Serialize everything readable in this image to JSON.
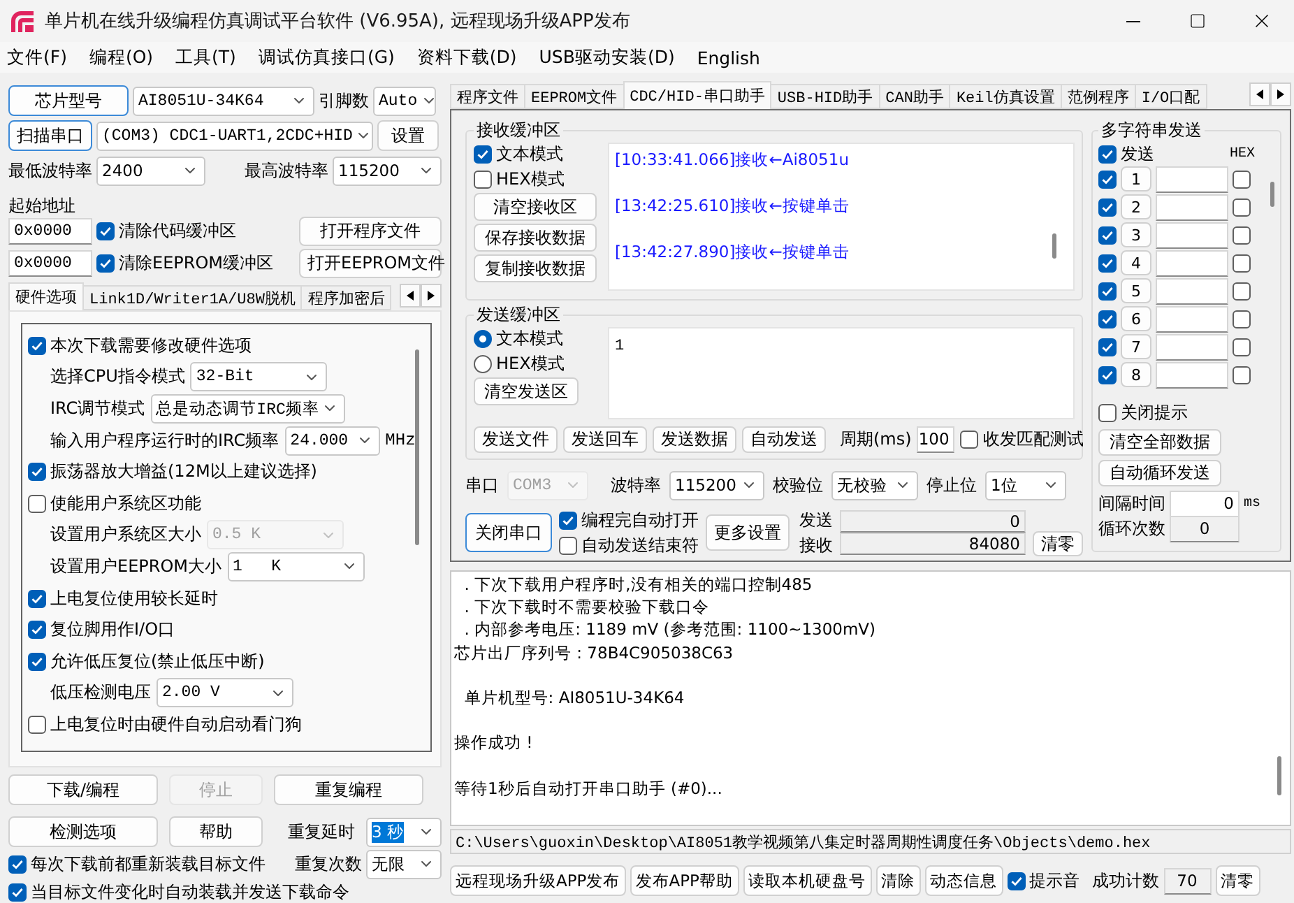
{
  "window": {
    "title": "单片机在线升级编程仿真调试平台软件 (V6.95A), 远程现场升级APP发布"
  },
  "menu": [
    "文件(F)",
    "编程(O)",
    "工具(T)",
    "调试仿真接口(G)",
    "资料下载(D)",
    "USB驱动安装(D)",
    "English"
  ],
  "chip": {
    "button": {
      "label": "芯片型号",
      "focused": true
    },
    "model": "AI8051U-34K64",
    "pins_label": "引脚数",
    "pins": "Auto"
  },
  "port": {
    "button": {
      "label": "扫描串口",
      "focused": true
    },
    "value": "(COM3) CDC1-UART1,2CDC+HID",
    "settings": "设置"
  },
  "baud": {
    "min_label": "最低波特率",
    "min": "2400",
    "max_label": "最高波特率",
    "max": "115200"
  },
  "start_address": {
    "label": "起始地址",
    "rows": [
      {
        "address": "0x0000",
        "label": "清除代码缓冲区",
        "checked": true,
        "button": "打开程序文件"
      },
      {
        "address": "0x0000",
        "label": "清除EEPROM缓冲区",
        "checked": true,
        "button": "打开EEPROM文件"
      }
    ]
  },
  "option_tabs": [
    {
      "label": "硬件选项",
      "selected": true
    },
    {
      "label": "Link1D/Writer1A/U8W脱机",
      "selected": false
    },
    {
      "label": "程序加密后",
      "selected": false
    }
  ],
  "hardware_options": [
    {
      "kind": "check",
      "label": "本次下载需要修改硬件选项",
      "checked": true
    },
    {
      "kind": "select",
      "label": "选择CPU指令模式",
      "value": "32-Bit",
      "disabled": false
    },
    {
      "kind": "select",
      "label": "IRC调节模式",
      "value": "总是动态调节IRC频率",
      "disabled": false
    },
    {
      "kind": "select",
      "label": "输入用户程序运行时的IRC频率",
      "value": "24.000",
      "unit": "MHz",
      "disabled": false
    },
    {
      "kind": "check",
      "label": "振荡器放大增益(12M以上建议选择)",
      "checked": true
    },
    {
      "kind": "check",
      "label": "使能用户系统区功能",
      "checked": false
    },
    {
      "kind": "select",
      "label": "设置用户系统区大小",
      "value": "0.5 K",
      "disabled": true
    },
    {
      "kind": "select",
      "label": "设置用户EEPROM大小",
      "value": "1   K",
      "disabled": false
    },
    {
      "kind": "check",
      "label": "上电复位使用较长延时",
      "checked": true
    },
    {
      "kind": "check",
      "label": "复位脚用作I/O口",
      "checked": true
    },
    {
      "kind": "check",
      "label": "允许低压复位(禁止低压中断)",
      "checked": true
    },
    {
      "kind": "select",
      "label": "低压检测电压",
      "value": "2.00 V",
      "disabled": false
    },
    {
      "kind": "check",
      "label": "上电复位时由硬件自动启动看门狗",
      "checked": false
    }
  ],
  "actions": [
    {
      "label": "下载/编程",
      "disabled": false
    },
    {
      "label": "停止",
      "disabled": true
    },
    {
      "label": "重复编程",
      "disabled": false
    },
    {
      "label": "检测选项",
      "disabled": false
    },
    {
      "label": "帮助",
      "disabled": false
    }
  ],
  "repeat_delay": {
    "label": "重复延时",
    "value": "3 秒",
    "highlighted": true
  },
  "repeat_count": {
    "label": "重复次数",
    "value": "无限"
  },
  "load_options": [
    {
      "label": "每次下载前都重新装载目标文件",
      "checked": true
    },
    {
      "label": "当目标文件变化时自动装载并发送下载命令",
      "checked": true
    }
  ],
  "tool_tabs": [
    {
      "label": "程序文件",
      "selected": false
    },
    {
      "label": "EEPROM文件",
      "selected": false
    },
    {
      "label": "CDC/HID-串口助手",
      "selected": true
    },
    {
      "label": "USB-HID助手",
      "selected": false
    },
    {
      "label": "CAN助手",
      "selected": false
    },
    {
      "label": "Keil仿真设置",
      "selected": false
    },
    {
      "label": "范例程序",
      "selected": false
    },
    {
      "label": "I/O口配",
      "selected": false
    }
  ],
  "receive": {
    "title": "接收缓冲区",
    "modes": [
      {
        "label": "文本模式",
        "checked": true
      },
      {
        "label": "HEX模式",
        "checked": false
      }
    ],
    "buttons": [
      "清空接收区",
      "保存接收数据",
      "复制接收数据"
    ],
    "lines": [
      "[10:33:41.066]接收←Ai8051u",
      "[13:42:25.610]接收←按键单击",
      "[13:42:27.890]接收←按键单击"
    ]
  },
  "send": {
    "title": "发送缓冲区",
    "modes": [
      {
        "label": "文本模式",
        "selected": true
      },
      {
        "label": "HEX模式",
        "selected": false
      }
    ],
    "clear": "清空发送区",
    "value": "1",
    "buttons": [
      "发送文件",
      "发送回车",
      "发送数据",
      "自动发送"
    ],
    "period_label": "周期(ms)",
    "period": "100",
    "match_test": {
      "label": "收发匹配测试",
      "checked": false
    }
  },
  "serial": {
    "port_label": "串口",
    "port": "COM3",
    "baud_label": "波特率",
    "baud": "115200",
    "parity_label": "校验位",
    "parity": "无校验",
    "stop_label": "停止位",
    "stop": "1位"
  },
  "connection": {
    "button": {
      "label": "关闭串口",
      "focused": true
    },
    "options": [
      {
        "label": "编程完自动打开",
        "checked": true
      },
      {
        "label": "自动发送结束符",
        "checked": false
      }
    ],
    "more": "更多设置",
    "sent_label": "发送",
    "sent": "0",
    "received_label": "接收",
    "received": "84080",
    "reset": "清零"
  },
  "multi_send": {
    "title": "多字符串发送",
    "send_all": {
      "label": "发送",
      "checked": true
    },
    "hex_label": "HEX",
    "rows": [
      {
        "label": "1",
        "checked": true,
        "hex": false
      },
      {
        "label": "2",
        "checked": true,
        "hex": false
      },
      {
        "label": "3",
        "checked": true,
        "hex": false
      },
      {
        "label": "4",
        "checked": true,
        "hex": false
      },
      {
        "label": "5",
        "checked": true,
        "hex": false
      },
      {
        "label": "6",
        "checked": true,
        "hex": false
      },
      {
        "label": "7",
        "checked": true,
        "hex": false
      },
      {
        "label": "8",
        "checked": true,
        "hex": false
      }
    ],
    "close_tip": {
      "label": "关闭提示",
      "checked": false
    },
    "buttons": [
      "清空全部数据",
      "自动循环发送"
    ],
    "interval_label": "间隔时间",
    "interval": "0",
    "interval_unit": "ms",
    "loops_label": "循环次数",
    "loops": "0"
  },
  "log": "  . 下次下载用户程序时,没有相关的端口控制485\n  . 下次下载时不需要校验下载口令\n  . 内部参考电压: 1189 mV (参考范围: 1100~1300mV)\n芯片出厂序列号 : 78B4C905038C63\n\n  单片机型号: AI8051U-34K64\n\n操作成功 !\n\n等待1秒后自动打开串口助手 (#0)...",
  "file_path": "C:\\Users\\guoxin\\Desktop\\AI8051教学视频第八集定时器周期性调度任务\\Objects\\demo.hex",
  "footer": {
    "buttons": [
      "远程现场升级APP发布",
      "发布APP帮助",
      "读取本机硬盘号",
      "清除",
      "动态信息"
    ],
    "sound": {
      "label": "提示音",
      "checked": true
    },
    "count_label": "成功计数",
    "count": "70",
    "reset": "清零"
  }
}
